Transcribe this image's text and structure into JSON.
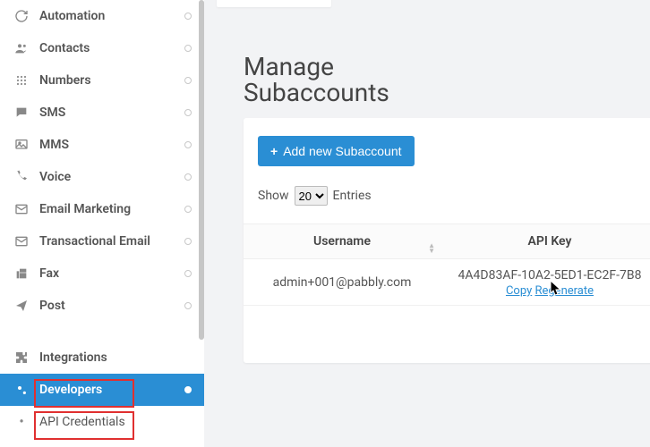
{
  "sidebar": {
    "items": [
      {
        "label": "Automation",
        "icon": "refresh"
      },
      {
        "label": "Contacts",
        "icon": "users"
      },
      {
        "label": "Numbers",
        "icon": "dial"
      },
      {
        "label": "SMS",
        "icon": "comment"
      },
      {
        "label": "MMS",
        "icon": "image"
      },
      {
        "label": "Voice",
        "icon": "phone"
      },
      {
        "label": "Email Marketing",
        "icon": "envelope"
      },
      {
        "label": "Transactional Email",
        "icon": "envelope"
      },
      {
        "label": "Fax",
        "icon": "fax"
      },
      {
        "label": "Post",
        "icon": "plane"
      }
    ],
    "section2": [
      {
        "label": "Integrations",
        "icon": "puzzle",
        "showCircle": false
      },
      {
        "label": "Developers",
        "icon": "cogs",
        "active": true
      }
    ],
    "sub": {
      "label": "API Credentials"
    }
  },
  "page": {
    "title_line1": "Manage",
    "title_line2": "Subaccounts"
  },
  "card": {
    "add_button": "Add new Subaccount",
    "show_label": "Show",
    "entries_label": "Entries",
    "page_size": "20",
    "columns": {
      "username": "Username",
      "apikey": "API Key"
    },
    "rows": [
      {
        "username": "admin+001@pabbly.com",
        "apikey": "4A4D83AF-10A2-5ED1-EC2F-7B8",
        "copy": "Copy",
        "regen": "Regenerate"
      }
    ]
  }
}
